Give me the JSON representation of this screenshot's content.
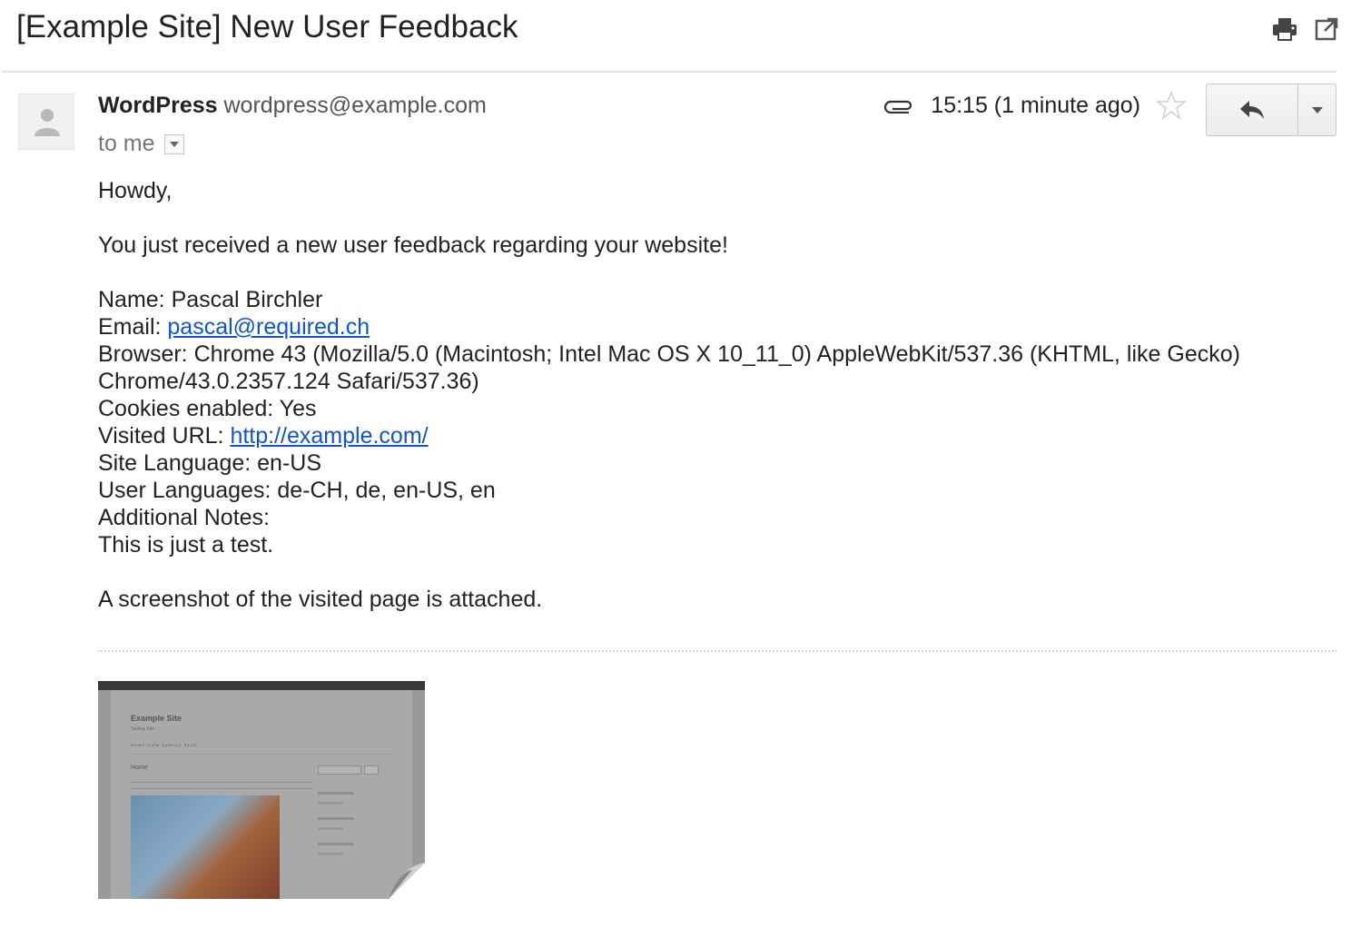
{
  "subject": "[Example Site] New User Feedback",
  "sender": {
    "name": "WordPress",
    "email": "wordpress@example.com",
    "recipient": "to me"
  },
  "meta": {
    "time": "15:15 (1 minute ago)"
  },
  "body": {
    "greeting": "Howdy,",
    "intro": "You just received a new user feedback regarding your website!",
    "name_line": "Name: Pascal Birchler",
    "email_label": "Email: ",
    "email_link": "pascal@required.ch",
    "browser_line1": "Browser: Chrome 43 (Mozilla/5.0 (Macintosh; Intel Mac OS X 10_11_0) AppleWebKit/537.36 (KHTML, like Gecko)",
    "browser_line2": "Chrome/43.0.2357.124 Safari/537.36)",
    "cookies_line": "Cookies enabled: Yes",
    "url_label": "Visited URL: ",
    "url_link": "http://example.com/",
    "site_lang_line": "Site Language: en-US",
    "user_lang_line": "User Languages: de-CH, de, en-US, en",
    "notes_label": "Additional Notes:",
    "notes_text": "This is just a test.",
    "outro": "A screenshot of the visited page is attached."
  },
  "attachment": {
    "site_title": "Example Site",
    "site_tagline": "Testing Site",
    "nav": "HOME     VIEW     SAMPLE PAGE",
    "page_heading": "Home"
  },
  "icons": {
    "print": "print-icon",
    "popout": "new-window-icon",
    "attachment": "paperclip-icon",
    "star": "star-icon",
    "reply": "reply-icon",
    "more": "caret-down-icon",
    "avatar": "person-icon"
  }
}
